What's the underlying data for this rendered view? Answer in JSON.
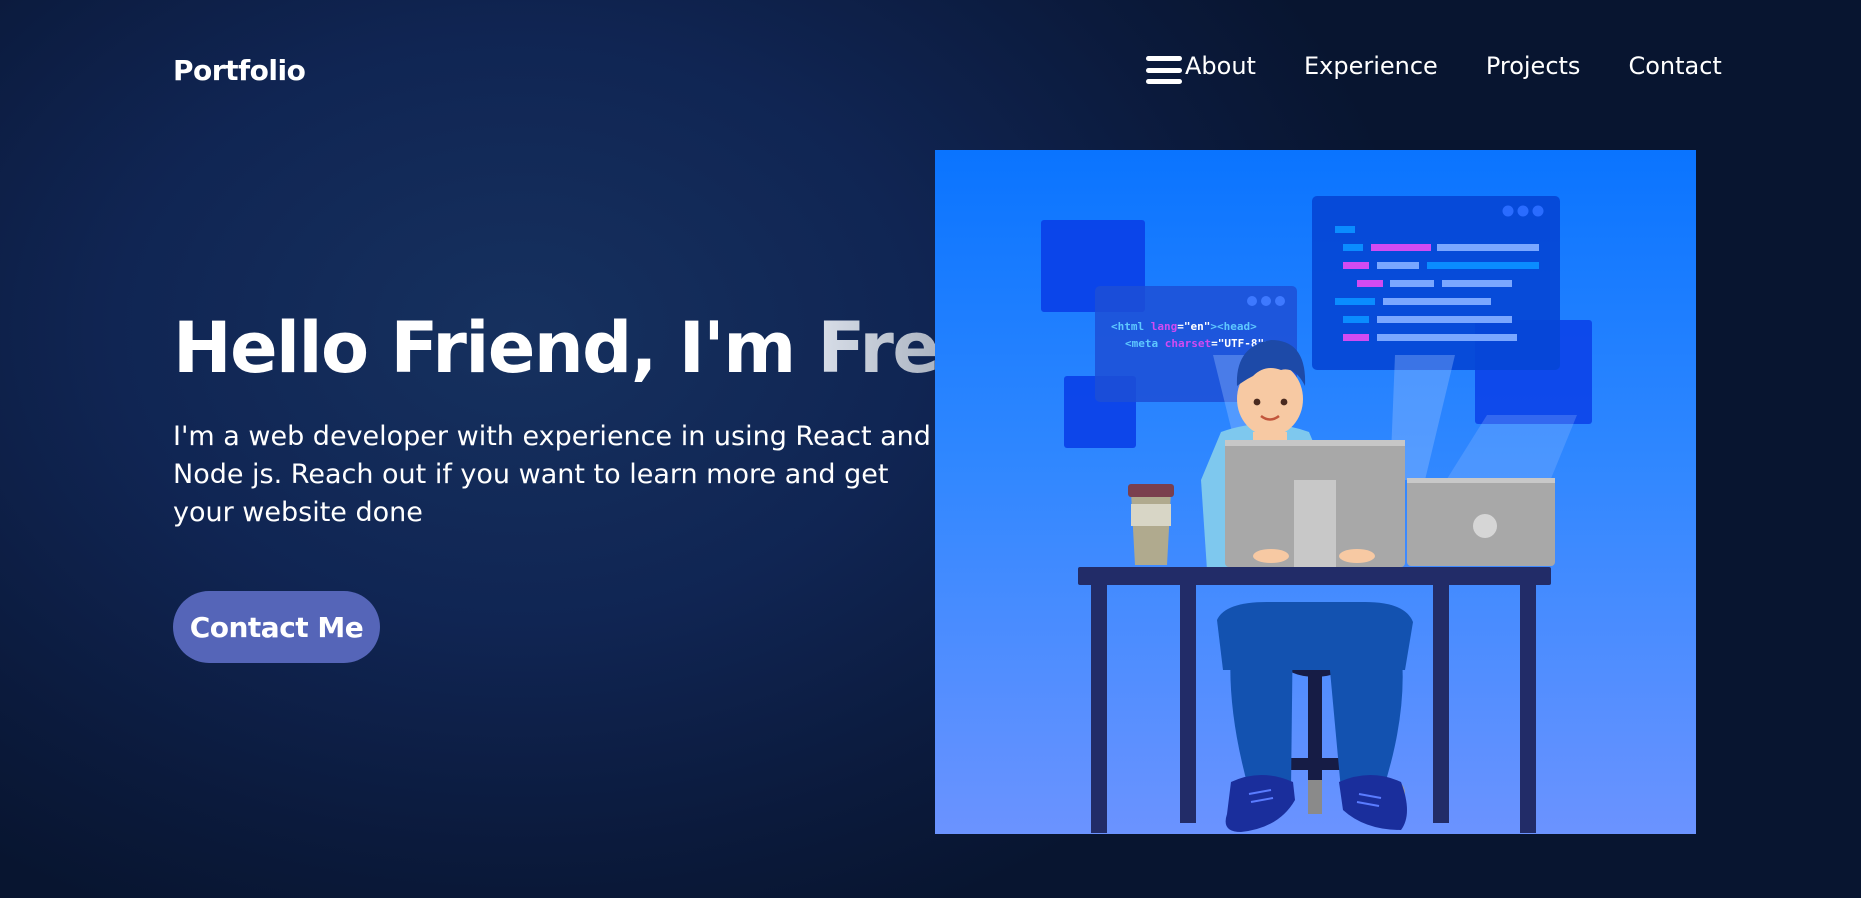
{
  "nav": {
    "logo": "Portfolio",
    "links": [
      {
        "label": "About"
      },
      {
        "label": "Experience"
      },
      {
        "label": "Projects"
      },
      {
        "label": "Contact"
      }
    ],
    "menu_icon": "hamburger-menu-icon"
  },
  "hero": {
    "greeting": "Hello Friend, I'm",
    "name": "Fred",
    "description": "I'm a web developer with experience in using React and Node js. Reach out if you want to learn more and get your website done",
    "cta_label": "Contact Me",
    "illustration": {
      "code_line_1": {
        "open": "<html ",
        "attr": "lang",
        "eq": "=",
        "val": "\"en\"",
        "close": "><head>"
      },
      "code_line_2": {
        "open": "<meta ",
        "attr": "charset",
        "eq": "=",
        "val": "\"UTF-8\"",
        "close": ">"
      }
    }
  },
  "colors": {
    "background": "#0f2350",
    "button": "#5565b8",
    "illustration_bg_top": "#0a74ff",
    "illustration_bg_bottom": "#6b93ff"
  }
}
